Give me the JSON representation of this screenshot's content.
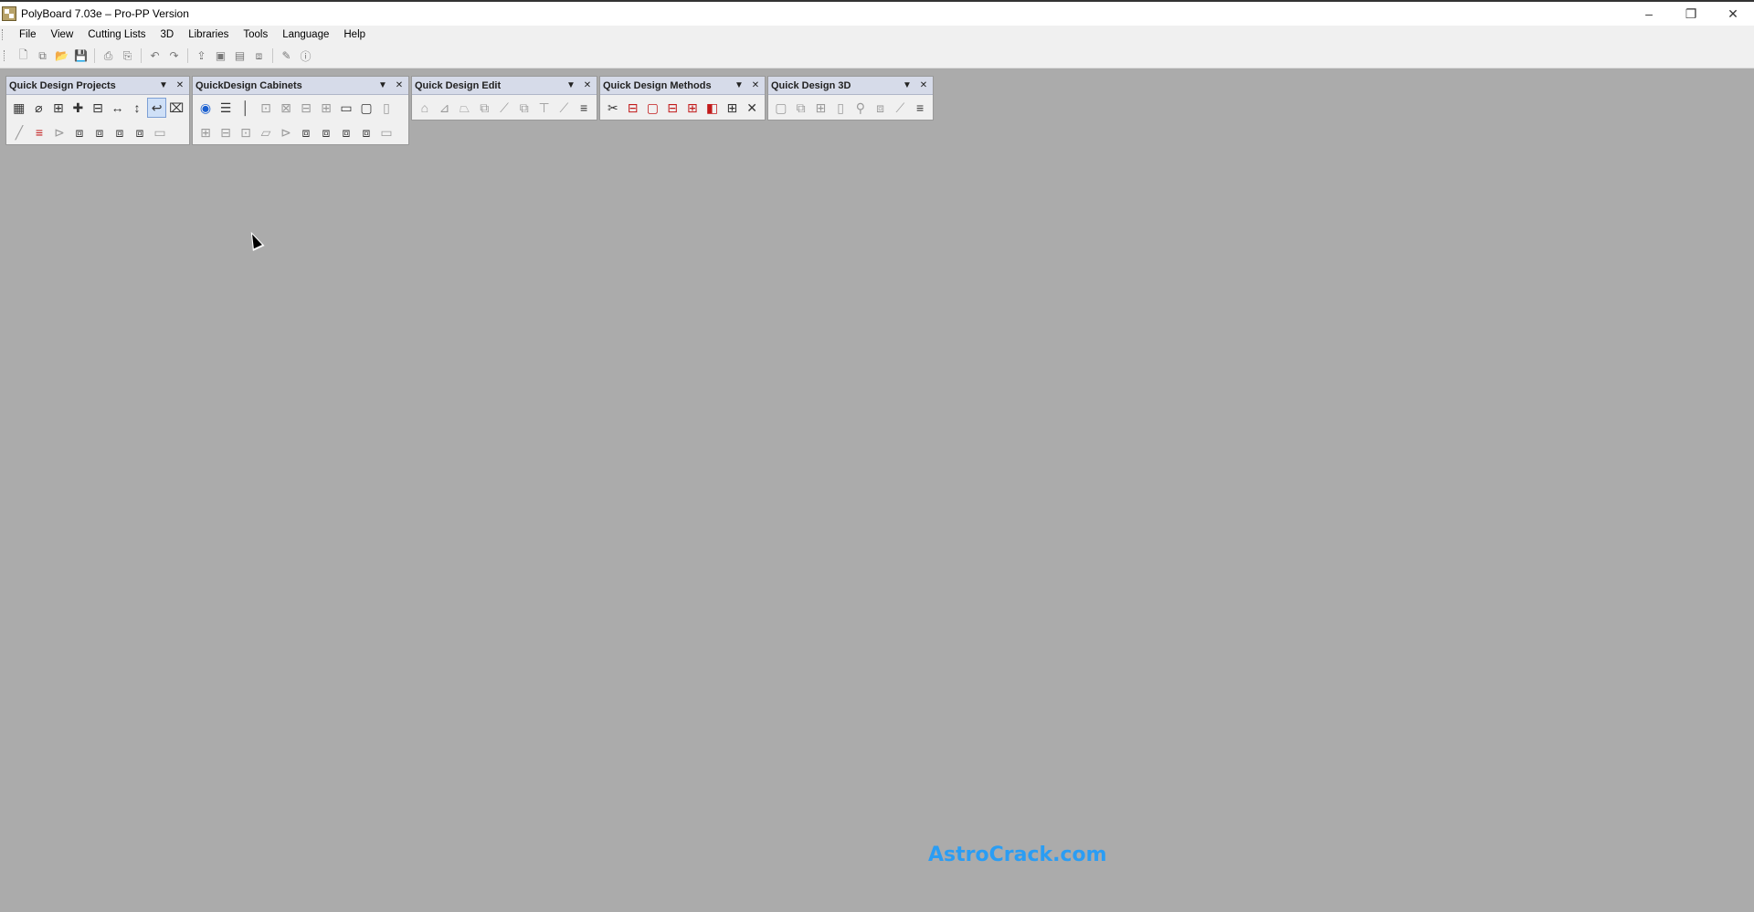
{
  "window": {
    "title": "PolyBoard 7.03e – Pro-PP Version",
    "controls": {
      "minimize": "–",
      "restore": "❐",
      "close": "✕"
    }
  },
  "menu": [
    "File",
    "View",
    "Cutting Lists",
    "3D",
    "Libraries",
    "Tools",
    "Language",
    "Help"
  ],
  "toolbar": {
    "icons": [
      "new-file-icon",
      "copy-file-icon",
      "open-folder-icon",
      "save-icon",
      "print-icon",
      "print-preview-icon",
      "undo-icon",
      "redo-icon",
      "export-icon",
      "box-icon",
      "box-list-icon",
      "box-3d-icon",
      "tools-icon",
      "info-icon"
    ],
    "glyphs": [
      "🗋",
      "⧉",
      "📂",
      "💾",
      "⎙",
      "⎘",
      "↶",
      "↷",
      "⇪",
      "▣",
      "▤",
      "⧈",
      "✎",
      "ⓘ"
    ]
  },
  "panels": [
    {
      "title": "Quick Design Projects",
      "rows": [
        [
          "▦",
          "⌀",
          "⊞",
          "✚",
          "⊟",
          "↔",
          "↕",
          "↩",
          "⌧"
        ],
        [
          "╱",
          "≡",
          "⊳",
          "⧈",
          "⧈",
          "⧈",
          "⧈",
          "▭"
        ]
      ],
      "active": "↩"
    },
    {
      "title": "QuickDesign Cabinets",
      "rows": [
        [
          "◉",
          "☰",
          "│",
          "⊡",
          "⊠",
          "⊟",
          "⊞",
          "▭",
          "▢",
          "▯"
        ],
        [
          "⊞",
          "⊟",
          "⊡",
          "▱",
          "⊳",
          "⧈",
          "⧈",
          "⧈",
          "⧈",
          "▭"
        ]
      ]
    },
    {
      "title": "Quick Design Edit",
      "rows": [
        [
          "⌂",
          "⊿",
          "⏢",
          "⧉",
          "⟋",
          "⧉",
          "⊤",
          "⟋",
          "≡"
        ]
      ]
    },
    {
      "title": "Quick Design Methods",
      "rows": [
        [
          "✂",
          "⊟",
          "▢",
          "⊟",
          "⊞",
          "◧",
          "⊞",
          "✕"
        ]
      ]
    },
    {
      "title": "Quick Design 3D",
      "rows": [
        [
          "▢",
          "⧉",
          "⊞",
          "▯",
          "⚲",
          "⧈",
          "⟋",
          "≡"
        ]
      ]
    }
  ],
  "watermark": "AstroCrack.com"
}
